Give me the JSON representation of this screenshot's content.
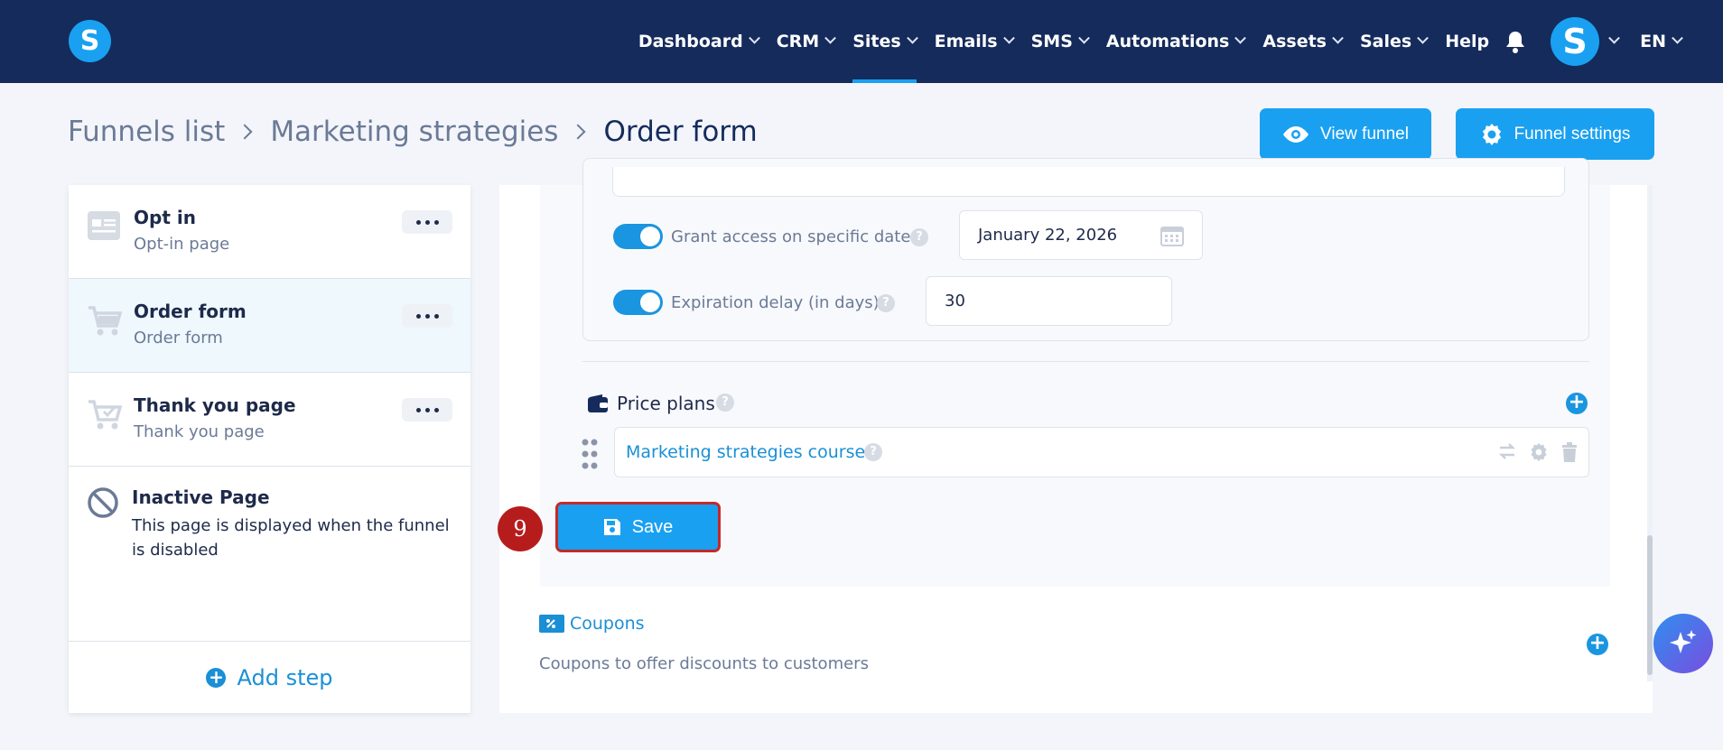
{
  "app": {
    "logo_letter": "S"
  },
  "nav": {
    "items": [
      {
        "label": "Dashboard",
        "has_dropdown": true
      },
      {
        "label": "CRM",
        "has_dropdown": true
      },
      {
        "label": "Sites",
        "has_dropdown": true,
        "active": true
      },
      {
        "label": "Emails",
        "has_dropdown": true
      },
      {
        "label": "SMS",
        "has_dropdown": true
      },
      {
        "label": "Automations",
        "has_dropdown": true
      },
      {
        "label": "Assets",
        "has_dropdown": true
      },
      {
        "label": "Sales",
        "has_dropdown": true
      },
      {
        "label": "Help",
        "has_dropdown": false
      }
    ],
    "avatar_letter": "S",
    "language": "EN",
    "accent_color": "#1aa0f0",
    "bar_color": "#152b5c"
  },
  "breadcrumb": {
    "items": [
      "Funnels list",
      "Marketing strategies"
    ],
    "current": "Order form"
  },
  "header_actions": {
    "view_funnel": "View funnel",
    "funnel_settings": "Funnel settings"
  },
  "steps": [
    {
      "title": "Opt in",
      "subtitle": "Opt-in page",
      "icon": "opt-in-page-icon"
    },
    {
      "title": "Order form",
      "subtitle": "Order form",
      "icon": "cart-icon",
      "selected": true
    },
    {
      "title": "Thank you page",
      "subtitle": "Thank you page",
      "icon": "cart-check-icon"
    }
  ],
  "inactive_page": {
    "title": "Inactive Page",
    "description": "This page is displayed when the funnel is disabled"
  },
  "add_step_label": "Add step",
  "access": {
    "grant_label": "Grant access on specific date",
    "grant_enabled": true,
    "grant_date": "January 22, 2026",
    "expiration_label": "Expiration delay (in days)",
    "expiration_enabled": true,
    "expiration_value": "30",
    "help_glyph": "?"
  },
  "price_plans": {
    "label": "Price plans",
    "plans": [
      {
        "name": "Marketing strategies course"
      }
    ]
  },
  "save_label": "Save",
  "annotation": {
    "step_number": "9",
    "color": "#b71c1c"
  },
  "coupons": {
    "title": "Coupons",
    "description": "Coupons to offer discounts to customers"
  }
}
